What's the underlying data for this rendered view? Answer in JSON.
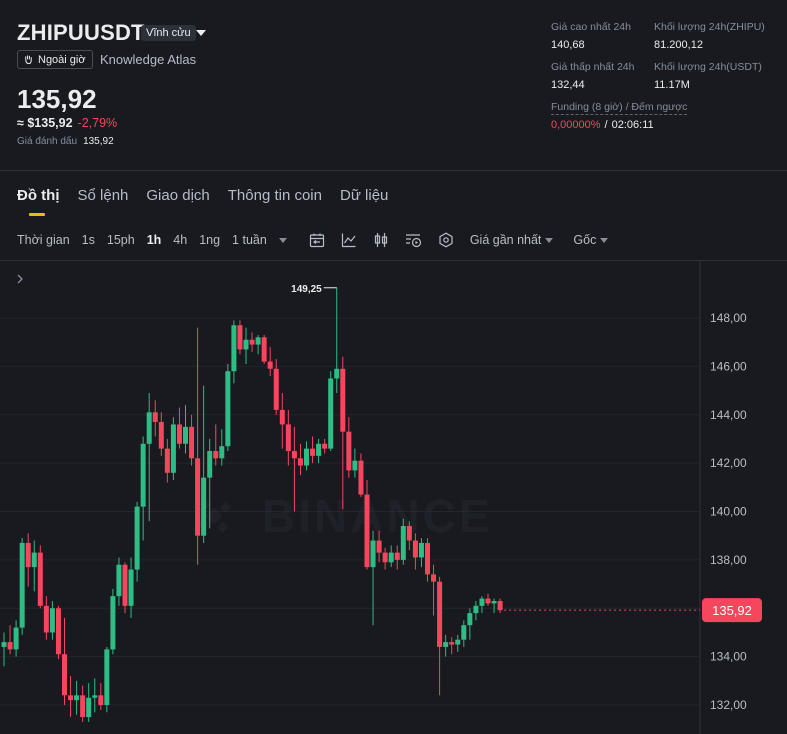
{
  "header": {
    "symbol": "ZHIPUUSDT",
    "contract_type": "Vĩnh cửu",
    "after_hours_label": "Ngoài giờ",
    "company": "Knowledge Atlas",
    "last_price": "135,92",
    "usd_price": "≈ $135,92",
    "change_pct": "-2,79%",
    "mark_price_label": "Giá đánh dấu",
    "mark_price": "135,92"
  },
  "stats": {
    "high_label": "Giá cao nhất 24h",
    "high_value": "140,68",
    "vol_base_label": "Khối lượng 24h(ZHIPU)",
    "vol_base_value": "81.200,12",
    "low_label": "Giá thấp nhất 24h",
    "low_value": "132,44",
    "vol_quote_label": "Khối lượng 24h(USDT)",
    "vol_quote_value": "11.17M",
    "funding_label": "Funding (8 giờ) / Đếm ngược",
    "funding_rate": "0,00000%",
    "funding_sep": "/",
    "countdown": "02:06:11"
  },
  "tabs": [
    "Đồ thị",
    "Sổ lệnh",
    "Giao dịch",
    "Thông tin coin",
    "Dữ liệu"
  ],
  "toolbar": {
    "time_label": "Thời gian",
    "intervals": [
      "1s",
      "15ph",
      "1h",
      "4h",
      "1ng",
      "1 tuần"
    ],
    "active_interval": "1h",
    "icons": [
      "calendar-icon",
      "line-chart-icon",
      "candlestick-icon",
      "replay-icon",
      "indicator-icon"
    ],
    "price_type": "Giá gần nhất",
    "scale": "Gốc"
  },
  "colors": {
    "background": "#181a20",
    "up": "#2ebd85",
    "down": "#f6465d",
    "accent": "#f0b90b",
    "text_primary": "#eaecef",
    "text_secondary": "#848e9c"
  },
  "chart_data": {
    "type": "candlestick",
    "interval": "1h",
    "watermark": "BINANCE",
    "y_ticks": [
      "148,00",
      "146,00",
      "144,00",
      "142,00",
      "140,00",
      "138,00",
      "136,00",
      "134,00",
      "132,00"
    ],
    "y_tick_values": [
      148,
      146,
      144,
      142,
      140,
      138,
      136,
      134,
      132
    ],
    "ylim": [
      131.3,
      149.9
    ],
    "high_annotation": "149,25",
    "last_price_label": "135,92",
    "last_price": 135.92,
    "candles": [
      {
        "o": 134.4,
        "h": 135.0,
        "l": 133.6,
        "c": 134.6
      },
      {
        "o": 134.6,
        "h": 135.3,
        "l": 134.1,
        "c": 134.3
      },
      {
        "o": 134.3,
        "h": 135.5,
        "l": 134.0,
        "c": 135.2
      },
      {
        "o": 135.2,
        "h": 138.9,
        "l": 134.9,
        "c": 138.7
      },
      {
        "o": 138.7,
        "h": 139.1,
        "l": 136.9,
        "c": 137.7
      },
      {
        "o": 137.7,
        "h": 138.8,
        "l": 136.7,
        "c": 138.3
      },
      {
        "o": 138.3,
        "h": 138.6,
        "l": 136.0,
        "c": 136.1
      },
      {
        "o": 136.1,
        "h": 136.5,
        "l": 134.7,
        "c": 135.0
      },
      {
        "o": 135.0,
        "h": 136.3,
        "l": 134.7,
        "c": 136.0
      },
      {
        "o": 136.0,
        "h": 136.1,
        "l": 133.9,
        "c": 134.1
      },
      {
        "o": 134.1,
        "h": 135.6,
        "l": 132.0,
        "c": 132.4
      },
      {
        "o": 132.4,
        "h": 133.2,
        "l": 131.5,
        "c": 132.2
      },
      {
        "o": 132.2,
        "h": 133.0,
        "l": 131.6,
        "c": 132.4
      },
      {
        "o": 132.4,
        "h": 132.8,
        "l": 131.3,
        "c": 131.5
      },
      {
        "o": 131.5,
        "h": 132.9,
        "l": 131.3,
        "c": 132.3
      },
      {
        "o": 132.3,
        "h": 133.1,
        "l": 131.7,
        "c": 132.4
      },
      {
        "o": 132.4,
        "h": 132.9,
        "l": 131.8,
        "c": 132.0
      },
      {
        "o": 132.0,
        "h": 134.4,
        "l": 131.7,
        "c": 134.3
      },
      {
        "o": 134.3,
        "h": 136.8,
        "l": 134.1,
        "c": 136.5
      },
      {
        "o": 136.5,
        "h": 138.1,
        "l": 136.1,
        "c": 137.8
      },
      {
        "o": 137.8,
        "h": 137.9,
        "l": 135.8,
        "c": 136.1
      },
      {
        "o": 136.1,
        "h": 138.1,
        "l": 135.6,
        "c": 137.6
      },
      {
        "o": 137.6,
        "h": 140.4,
        "l": 137.1,
        "c": 140.2
      },
      {
        "o": 140.2,
        "h": 143.1,
        "l": 138.8,
        "c": 142.8
      },
      {
        "o": 142.8,
        "h": 144.9,
        "l": 139.6,
        "c": 144.1
      },
      {
        "o": 144.1,
        "h": 144.6,
        "l": 143.1,
        "c": 143.7
      },
      {
        "o": 143.7,
        "h": 144.1,
        "l": 142.3,
        "c": 142.6
      },
      {
        "o": 142.6,
        "h": 143.0,
        "l": 141.2,
        "c": 141.6
      },
      {
        "o": 141.6,
        "h": 143.9,
        "l": 141.3,
        "c": 143.6
      },
      {
        "o": 143.6,
        "h": 144.3,
        "l": 142.6,
        "c": 142.8
      },
      {
        "o": 142.8,
        "h": 144.4,
        "l": 142.4,
        "c": 143.5
      },
      {
        "o": 143.5,
        "h": 144.0,
        "l": 141.9,
        "c": 142.2
      },
      {
        "o": 142.2,
        "h": 147.6,
        "l": 137.8,
        "c": 139.0
      },
      {
        "o": 139.0,
        "h": 145.2,
        "l": 138.7,
        "c": 141.4
      },
      {
        "o": 141.4,
        "h": 143.0,
        "l": 139.3,
        "c": 142.5
      },
      {
        "o": 142.5,
        "h": 143.6,
        "l": 141.9,
        "c": 142.2
      },
      {
        "o": 142.2,
        "h": 143.4,
        "l": 141.9,
        "c": 142.7
      },
      {
        "o": 142.7,
        "h": 146.1,
        "l": 142.5,
        "c": 145.8
      },
      {
        "o": 145.8,
        "h": 147.9,
        "l": 145.3,
        "c": 147.7
      },
      {
        "o": 147.7,
        "h": 147.9,
        "l": 146.5,
        "c": 146.7
      },
      {
        "o": 146.7,
        "h": 147.6,
        "l": 146.1,
        "c": 147.1
      },
      {
        "o": 147.1,
        "h": 147.4,
        "l": 146.6,
        "c": 146.9
      },
      {
        "o": 146.9,
        "h": 147.3,
        "l": 146.5,
        "c": 147.2
      },
      {
        "o": 147.2,
        "h": 147.3,
        "l": 146.1,
        "c": 146.2
      },
      {
        "o": 146.2,
        "h": 146.8,
        "l": 145.6,
        "c": 145.9
      },
      {
        "o": 145.9,
        "h": 146.3,
        "l": 144.0,
        "c": 144.2
      },
      {
        "o": 144.2,
        "h": 144.9,
        "l": 142.6,
        "c": 143.6
      },
      {
        "o": 143.6,
        "h": 144.2,
        "l": 141.9,
        "c": 142.5
      },
      {
        "o": 142.5,
        "h": 143.5,
        "l": 140.0,
        "c": 142.2
      },
      {
        "o": 142.2,
        "h": 142.8,
        "l": 141.5,
        "c": 141.9
      },
      {
        "o": 141.9,
        "h": 142.9,
        "l": 141.7,
        "c": 142.6
      },
      {
        "o": 142.6,
        "h": 143.1,
        "l": 142.0,
        "c": 142.3
      },
      {
        "o": 142.3,
        "h": 143.0,
        "l": 142.0,
        "c": 142.8
      },
      {
        "o": 142.8,
        "h": 143.0,
        "l": 142.4,
        "c": 142.6
      },
      {
        "o": 142.6,
        "h": 145.8,
        "l": 142.5,
        "c": 145.5
      },
      {
        "o": 145.5,
        "h": 149.25,
        "l": 144.9,
        "c": 145.9
      },
      {
        "o": 145.9,
        "h": 146.4,
        "l": 140.1,
        "c": 143.3
      },
      {
        "o": 143.3,
        "h": 143.9,
        "l": 141.4,
        "c": 141.7
      },
      {
        "o": 141.7,
        "h": 142.6,
        "l": 141.4,
        "c": 142.1
      },
      {
        "o": 142.1,
        "h": 142.4,
        "l": 140.6,
        "c": 140.7
      },
      {
        "o": 140.7,
        "h": 141.3,
        "l": 137.6,
        "c": 137.7
      },
      {
        "o": 137.7,
        "h": 139.2,
        "l": 135.3,
        "c": 138.8
      },
      {
        "o": 138.8,
        "h": 139.2,
        "l": 137.9,
        "c": 138.3
      },
      {
        "o": 138.3,
        "h": 138.5,
        "l": 137.6,
        "c": 137.9
      },
      {
        "o": 137.9,
        "h": 138.6,
        "l": 137.7,
        "c": 138.3
      },
      {
        "o": 138.3,
        "h": 138.6,
        "l": 137.6,
        "c": 138.0
      },
      {
        "o": 138.0,
        "h": 139.7,
        "l": 137.8,
        "c": 139.4
      },
      {
        "o": 139.4,
        "h": 139.6,
        "l": 138.4,
        "c": 138.8
      },
      {
        "o": 138.8,
        "h": 139.1,
        "l": 137.6,
        "c": 138.1
      },
      {
        "o": 138.1,
        "h": 138.9,
        "l": 137.7,
        "c": 138.7
      },
      {
        "o": 138.7,
        "h": 138.9,
        "l": 137.1,
        "c": 137.4
      },
      {
        "o": 137.4,
        "h": 137.8,
        "l": 135.7,
        "c": 137.1
      },
      {
        "o": 137.1,
        "h": 137.3,
        "l": 132.4,
        "c": 134.4
      },
      {
        "o": 134.4,
        "h": 134.9,
        "l": 134.0,
        "c": 134.6
      },
      {
        "o": 134.6,
        "h": 134.8,
        "l": 134.1,
        "c": 134.5
      },
      {
        "o": 134.5,
        "h": 134.9,
        "l": 134.2,
        "c": 134.7
      },
      {
        "o": 134.7,
        "h": 135.5,
        "l": 134.4,
        "c": 135.3
      },
      {
        "o": 135.3,
        "h": 136.0,
        "l": 134.7,
        "c": 135.8
      },
      {
        "o": 135.8,
        "h": 136.3,
        "l": 135.5,
        "c": 136.1
      },
      {
        "o": 136.1,
        "h": 136.5,
        "l": 135.8,
        "c": 136.4
      },
      {
        "o": 136.4,
        "h": 136.6,
        "l": 136.1,
        "c": 136.2
      },
      {
        "o": 136.2,
        "h": 136.4,
        "l": 135.8,
        "c": 136.3
      },
      {
        "o": 136.3,
        "h": 136.4,
        "l": 135.8,
        "c": 135.92
      }
    ]
  }
}
